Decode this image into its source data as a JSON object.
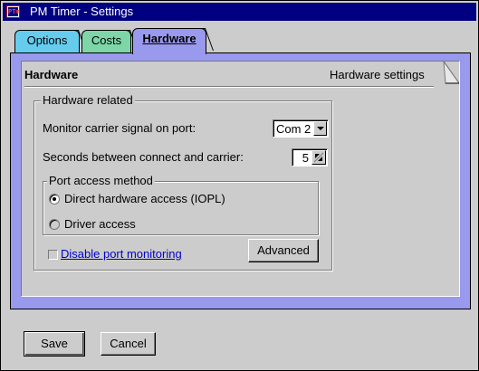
{
  "window": {
    "title": "PM Timer - Settings",
    "icon": "pmtimer-app-icon",
    "icon_text": "PTm"
  },
  "tabs": [
    {
      "label": "Options",
      "color": "#66ccee",
      "active": false
    },
    {
      "label": "Costs",
      "color": "#7ed6a8",
      "active": false
    },
    {
      "label": "Hardware",
      "color": "#9999ee",
      "active": true
    }
  ],
  "page": {
    "title": "Hardware",
    "subtitle": "Hardware settings"
  },
  "hardware_group": {
    "legend": "Hardware related",
    "carrier_label": "Monitor carrier signal on port:",
    "carrier_port": "Com 2",
    "seconds_label": "Seconds between connect and carrier:",
    "seconds_value": "5"
  },
  "port_access": {
    "legend": "Port access method",
    "options": [
      {
        "label": "Direct hardware access (IOPL)",
        "selected": true
      },
      {
        "label": "Driver access",
        "selected": false
      }
    ]
  },
  "disable_monitoring": {
    "label": "Disable port monitoring",
    "checked": false,
    "color": "#0000cc"
  },
  "buttons": {
    "advanced": "Advanced",
    "save": "Save",
    "cancel": "Cancel"
  }
}
